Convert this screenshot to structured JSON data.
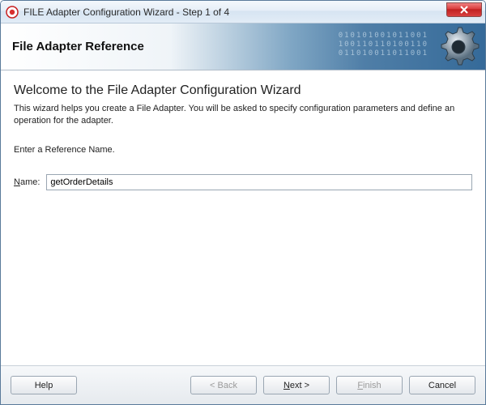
{
  "window": {
    "title": "FILE Adapter Configuration Wizard - Step 1 of 4"
  },
  "banner": {
    "title": "File Adapter Reference"
  },
  "content": {
    "heading": "Welcome to the File Adapter Configuration Wizard",
    "description": "This wizard helps you create a File Adapter. You will be asked to specify configuration parameters and define an operation for the adapter.",
    "prompt": "Enter a Reference Name.",
    "name_hotkey": "N",
    "name_label_rest": "ame:",
    "name_value": "getOrderDetails"
  },
  "buttons": {
    "help": "Help",
    "back": "< Back",
    "next_hotkey": "N",
    "next_rest": "ext >",
    "finish_hotkey": "F",
    "finish_rest": "inish",
    "cancel": "Cancel"
  }
}
